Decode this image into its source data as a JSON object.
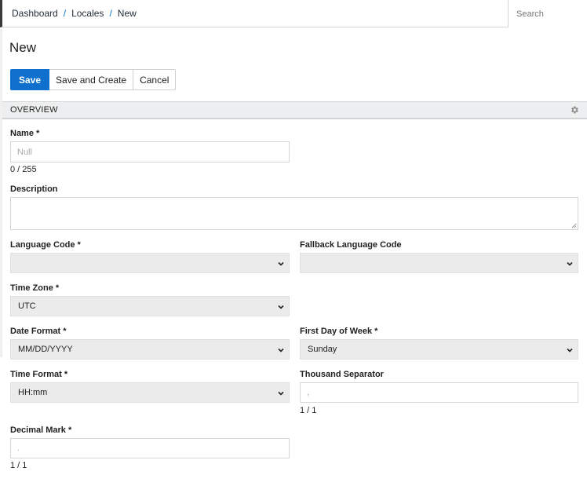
{
  "breadcrumb": {
    "items": [
      "Dashboard",
      "Locales",
      "New"
    ],
    "separator": "/"
  },
  "search": {
    "placeholder": "Search"
  },
  "page": {
    "title": "New"
  },
  "actions": {
    "save": "Save",
    "save_and_create": "Save and Create",
    "cancel": "Cancel"
  },
  "section": {
    "title": "OVERVIEW",
    "icon": "gear-icon"
  },
  "form": {
    "name": {
      "label": "Name *",
      "placeholder": "Null",
      "counter": "0 / 255"
    },
    "description": {
      "label": "Description"
    },
    "language_code": {
      "label": "Language Code *",
      "value": ""
    },
    "fallback_language_code": {
      "label": "Fallback Language Code",
      "value": ""
    },
    "time_zone": {
      "label": "Time Zone *",
      "value": "UTC"
    },
    "date_format": {
      "label": "Date Format *",
      "value": "MM/DD/YYYY"
    },
    "first_day_of_week": {
      "label": "First Day of Week *",
      "value": "Sunday"
    },
    "time_format": {
      "label": "Time Format *",
      "value": "HH:mm"
    },
    "thousand_separator": {
      "label": "Thousand Separator",
      "placeholder": ",",
      "counter": "1 / 1"
    },
    "decimal_mark": {
      "label": "Decimal Mark *",
      "placeholder": ".",
      "counter": "1 / 1"
    }
  },
  "colors": {
    "primary": "#0e70cc",
    "link_separator": "#0b6fc9",
    "section_bg": "#eceeef",
    "select_bg": "#ebebeb"
  }
}
